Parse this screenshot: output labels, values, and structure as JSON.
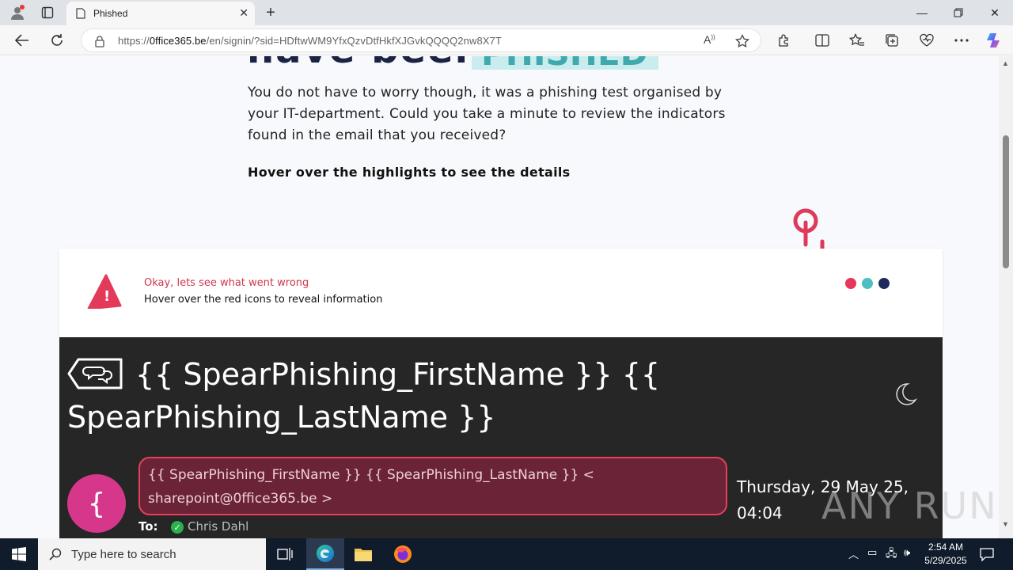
{
  "browser": {
    "tab_title": "Phished",
    "url_prefix": "https://",
    "url_domain": "0ffice365.be",
    "url_path": "/en/signin/?sid=HDftwWM9YfxQzvDtfHkfXJGvkQQQQ2nw8X7T"
  },
  "page": {
    "hero_title": "have been",
    "hero_badge": "PHISHED",
    "intro": "You do not have to worry though, it was a phishing test organised by your IT-department. Could you take a minute to review the indicators found in the email that you received?",
    "hover_hint": "Hover over the highlights to see the details",
    "card": {
      "title": "Okay, lets see what went wrong",
      "subtitle": "Hover over the red icons to reveal information",
      "dots": [
        "#e8365a",
        "#4dbfc1",
        "#1f2a5c"
      ]
    },
    "email": {
      "subject": "{{ SpearPhishing_FirstName }} {{ SpearPhishing_LastName }}",
      "avatar_letter": "{",
      "sender": "{{ SpearPhishing_FirstName }} {{ SpearPhishing_LastName }} < sharepoint@0ffice365.be >",
      "date": "Thursday, 29 May 25, 04:04",
      "to_label": "To:",
      "to_name": "Chris Dahl"
    }
  },
  "watermark": "ANY RUN",
  "taskbar": {
    "search_placeholder": "Type here to search",
    "time": "2:54 AM",
    "date": "5/29/2025"
  },
  "colors": {
    "accent_red": "#e5415e",
    "avatar_pink": "#d6378b",
    "email_bg": "#262626"
  }
}
